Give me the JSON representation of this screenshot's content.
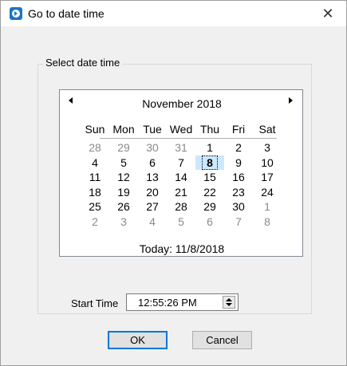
{
  "window": {
    "title": "Go to date time",
    "close_glyph": "✕"
  },
  "group": {
    "label": "Select date time"
  },
  "calendar": {
    "month_title": "November 2018",
    "weekdays": [
      "Sun",
      "Mon",
      "Tue",
      "Wed",
      "Thu",
      "Fri",
      "Sat"
    ],
    "weeks": [
      [
        [
          "28",
          1
        ],
        [
          "29",
          1
        ],
        [
          "30",
          1
        ],
        [
          "31",
          1
        ],
        [
          "1",
          0
        ],
        [
          "2",
          0
        ],
        [
          "3",
          0
        ]
      ],
      [
        [
          "4",
          0
        ],
        [
          "5",
          0
        ],
        [
          "6",
          0
        ],
        [
          "7",
          0
        ],
        [
          "8",
          0
        ],
        [
          "9",
          0
        ],
        [
          "10",
          0
        ]
      ],
      [
        [
          "11",
          0
        ],
        [
          "12",
          0
        ],
        [
          "13",
          0
        ],
        [
          "14",
          0
        ],
        [
          "15",
          0
        ],
        [
          "16",
          0
        ],
        [
          "17",
          0
        ]
      ],
      [
        [
          "18",
          0
        ],
        [
          "19",
          0
        ],
        [
          "20",
          0
        ],
        [
          "21",
          0
        ],
        [
          "22",
          0
        ],
        [
          "23",
          0
        ],
        [
          "24",
          0
        ]
      ],
      [
        [
          "25",
          0
        ],
        [
          "26",
          0
        ],
        [
          "27",
          0
        ],
        [
          "28",
          0
        ],
        [
          "29",
          0
        ],
        [
          "30",
          0
        ],
        [
          "1",
          1
        ]
      ],
      [
        [
          "2",
          1
        ],
        [
          "3",
          1
        ],
        [
          "4",
          1
        ],
        [
          "5",
          1
        ],
        [
          "6",
          1
        ],
        [
          "7",
          1
        ],
        [
          "8",
          1
        ]
      ]
    ],
    "selected_day": "8",
    "today_text": "Today: 11/8/2018"
  },
  "start_time": {
    "label": "Start Time",
    "value": "12:55:26 PM"
  },
  "buttons": {
    "ok": "OK",
    "cancel": "Cancel"
  },
  "colors": {
    "accent": "#0078d7",
    "selection": "#cce8ff",
    "app_icon": "#1a73c8"
  }
}
